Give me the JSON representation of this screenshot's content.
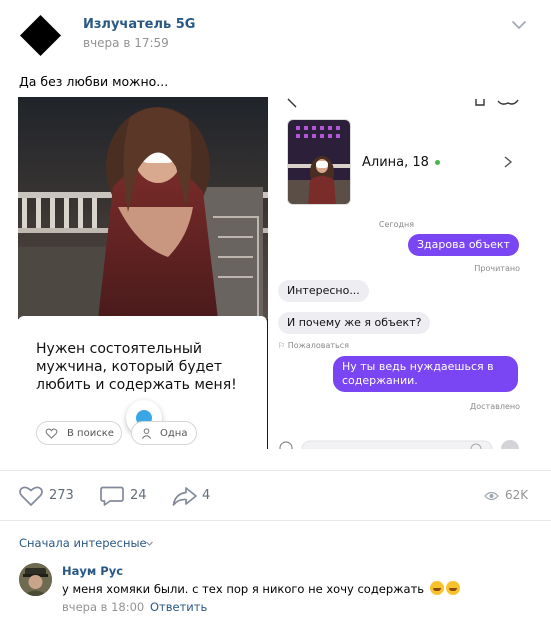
{
  "post": {
    "author": "Излучатель 5G",
    "time": "вчера в 17:59",
    "text": "Да без любви можно..."
  },
  "attachment": {
    "left_card": {
      "caption": "Нужен состоятельный мужчина, который будет любить и содержать меня!",
      "pill_search": "В поиске",
      "pill_alone": "Одна"
    },
    "chat": {
      "contact": "Алина, 18",
      "date_label": "Сегодня",
      "messages": [
        {
          "dir": "out",
          "text": "Здарова объект"
        },
        {
          "dir": "in",
          "text": "Интересно..."
        },
        {
          "dir": "in",
          "text": "И почему же я объект?"
        },
        {
          "dir": "out",
          "text": "Ну ты ведь нуждаешься в содержании."
        }
      ],
      "read_status": "Прочитано",
      "complain": "Пожаловаться",
      "delivered_status": "Доставлено",
      "colors": {
        "outgoing_bubble": "#7a45f2",
        "incoming_bubble": "#eeedf2",
        "online": "#4bb34b"
      }
    }
  },
  "actions": {
    "likes": "273",
    "comments": "24",
    "shares": "4",
    "views": "62K",
    "icons": [
      "heart-icon",
      "comment-icon",
      "share-icon",
      "eye-icon"
    ]
  },
  "comments": {
    "sort_label": "Сначала интересные",
    "items": [
      {
        "author": "Наум Рус",
        "text": "у меня хомяки были. с тех пор я никого не хочу содержать",
        "emoji": [
          "rofl-emoji",
          "rofl-emoji"
        ],
        "time": "вчера в 18:00",
        "reply": "Ответить"
      }
    ]
  },
  "theme": {
    "link": "#2a5885",
    "muted": "#939393",
    "divider": "#e7e8ec"
  }
}
